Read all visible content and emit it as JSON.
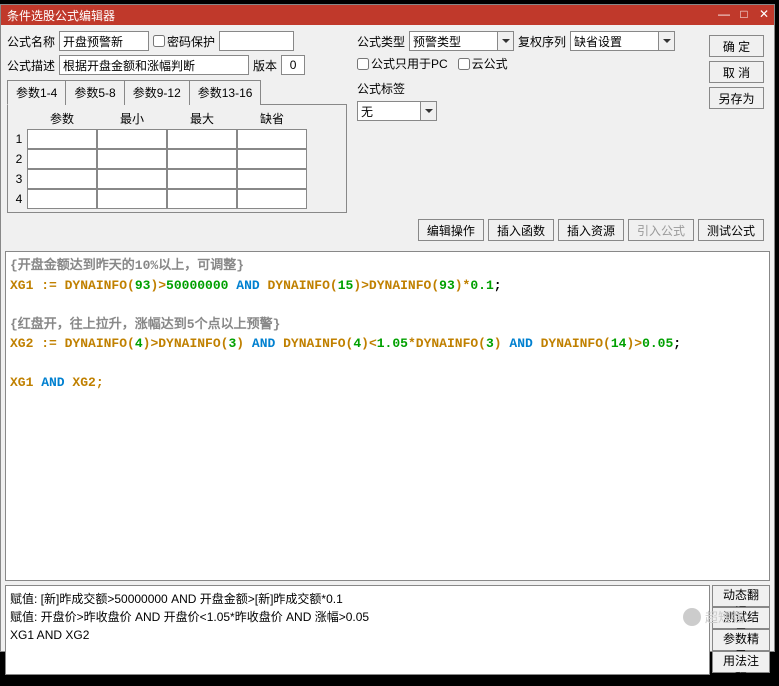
{
  "title": "条件选股公式编辑器",
  "labels": {
    "formula_name": "公式名称",
    "password_protect": "密码保护",
    "formula_type": "公式类型",
    "adjust_seq": "复权序列",
    "formula_desc": "公式描述",
    "version": "版本",
    "pc_only": "公式只用于PC",
    "cloud_formula": "云公式",
    "formula_tag": "公式标签"
  },
  "values": {
    "formula_name": "开盘预警新",
    "formula_type": "预警类型",
    "adjust_seq": "缺省设置",
    "formula_desc": "根据开盘金额和涨幅判断",
    "version": "0",
    "formula_tag": "无"
  },
  "buttons": {
    "confirm": "确  定",
    "cancel": "取  消",
    "save_as": "另存为",
    "edit_op": "编辑操作",
    "insert_func": "插入函数",
    "insert_res": "插入资源",
    "import_formula": "引入公式",
    "test_formula": "测试公式",
    "dyn_translate": "动态翻译",
    "test_result": "测试结果",
    "param_wizard": "参数精灵",
    "usage_note": "用法注释"
  },
  "tabs": {
    "t1": "参数1-4",
    "t2": "参数5-8",
    "t3": "参数9-12",
    "t4": "参数13-16"
  },
  "param_headers": {
    "h1": "参数",
    "h2": "最小",
    "h3": "最大",
    "h4": "缺省"
  },
  "param_rows": [
    "1",
    "2",
    "3",
    "4"
  ],
  "code": {
    "c1": "{开盘金额达到昨天的10%以上，可调整}",
    "l1_a": "XG1 := DYNAINFO(",
    "l1_n1": "93",
    "l1_b": ")>",
    "l1_n2": "50000000",
    "l1_and": " AND",
    "l1_c": " DYNAINFO(",
    "l1_n3": "15",
    "l1_d": ")>DYNAINFO(",
    "l1_n4": "93",
    "l1_e": ")*",
    "l1_n5": "0.1",
    "l1_f": ";",
    "c2": "{红盘开，往上拉升，涨幅达到5个点以上预警}",
    "l2_a": "XG2 := DYNAINFO(",
    "l2_n1": "4",
    "l2_b": ")>DYNAINFO(",
    "l2_n2": "3",
    "l2_b2": ")",
    "l2_and1": " AND",
    "l2_c": " DYNAINFO(",
    "l2_n3": "4",
    "l2_d": ")<",
    "l2_n4": "1.05",
    "l2_e": "*DYNAINFO(",
    "l2_n5": "3",
    "l2_e2": ")",
    "l2_and2": " AND",
    "l2_f": " DYNAINFO(",
    "l2_n6": "14",
    "l2_g": ")>",
    "l2_n7": "0.05",
    "l2_h": ";",
    "l3_a": "XG1",
    "l3_and": " AND",
    "l3_b": " XG2;"
  },
  "output": {
    "o1": "赋值: [新]昨成交额>50000000 AND 开盘金额>[新]昨成交额*0.1",
    "o2": "赋值: 开盘价>昨收盘价 AND 开盘价<1.05*昨收盘价 AND 涨幅>0.05",
    "o3": "XG1 AND XG2"
  },
  "watermark": "超短强"
}
